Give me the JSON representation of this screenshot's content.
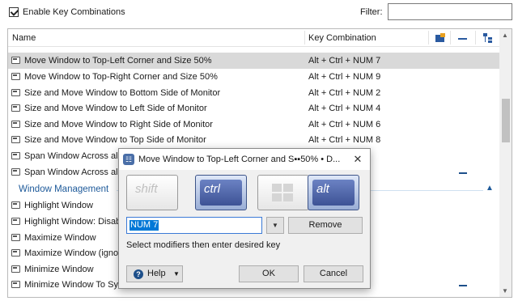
{
  "top": {
    "enable_label": "Enable Key Combinations",
    "filter_label": "Filter:",
    "filter_value": ""
  },
  "columns": {
    "name": "Name",
    "key": "Key Combination"
  },
  "rows": [
    {
      "name": "Move Window to Top-Left Corner and Size 50%",
      "key": "Alt + Ctrl + NUM 7",
      "selected": true
    },
    {
      "name": "Move Window to Top-Right Corner and Size 50%",
      "key": "Alt + Ctrl + NUM 9"
    },
    {
      "name": "Size and Move Window to Bottom Side of Monitor",
      "key": "Alt + Ctrl + NUM 2"
    },
    {
      "name": "Size and Move Window to Left Side of Monitor",
      "key": "Alt + Ctrl + NUM 4"
    },
    {
      "name": "Size and Move Window to Right Side of Monitor",
      "key": "Alt + Ctrl + NUM 6"
    },
    {
      "name": "Size and Move Window to Top Side of Monitor",
      "key": "Alt + Ctrl + NUM 8"
    },
    {
      "name": "Span Window Across all M",
      "key": ""
    },
    {
      "name": "Span Window Across all M",
      "key": ""
    }
  ],
  "group": {
    "name": "Window Management"
  },
  "group_rows": [
    {
      "name": "Highlight Window"
    },
    {
      "name": "Highlight Window: Disable"
    },
    {
      "name": "Maximize Window"
    },
    {
      "name": "Maximize Window (ignore"
    },
    {
      "name": "Minimize Window"
    },
    {
      "name": "Minimize Window To Syste"
    }
  ],
  "dialog": {
    "title": "Move Window to Top-Left Corner and S▪▪50% • D...",
    "close": "✕",
    "modifiers": {
      "shift": "shift",
      "ctrl": "ctrl",
      "alt": "alt"
    },
    "key_value": "NUM 7",
    "remove": "Remove",
    "hint": "Select modifiers then enter desired key",
    "help": "Help",
    "ok": "OK",
    "cancel": "Cancel"
  },
  "colors": {
    "accent": "#1e5a9a",
    "selection": "#d9d9d9",
    "modifier_on": "#3d5295"
  }
}
